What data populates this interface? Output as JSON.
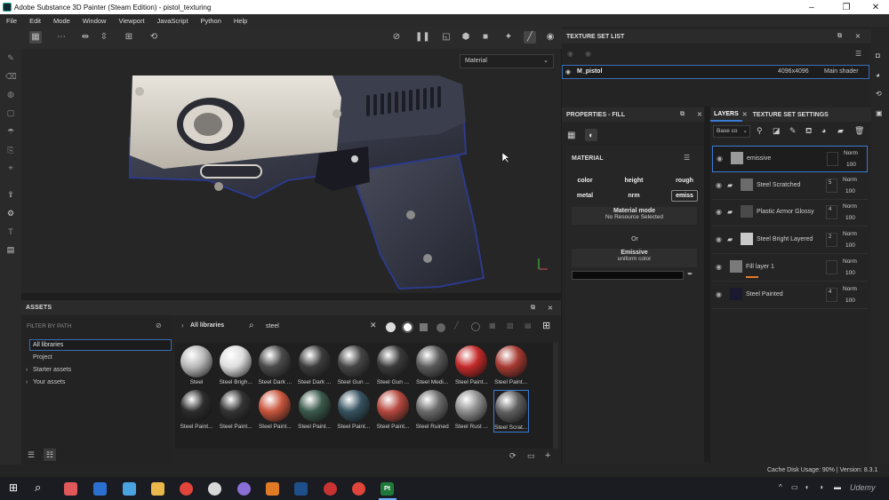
{
  "window": {
    "title": "Adobe Substance 3D Painter (Steam Edition) - pistol_texturing"
  },
  "menu": [
    "File",
    "Edit",
    "Mode",
    "Window",
    "Viewport",
    "JavaScript",
    "Python",
    "Help"
  ],
  "viewport": {
    "material_dropdown": "Material"
  },
  "texture_set_list": {
    "title": "TEXTURE SET LIST",
    "row": {
      "name": "M_pistol",
      "resolution": "4096x4096",
      "shader": "Main shader"
    }
  },
  "properties": {
    "title": "PROPERTIES - FILL",
    "section": "MATERIAL",
    "channels": [
      "color",
      "height",
      "rough",
      "metal",
      "nrm",
      "emiss"
    ],
    "material_mode_title": "Material mode",
    "material_mode_value": "No Resource Selected",
    "or_label": "Or",
    "emissive_title": "Emissive",
    "emissive_value": "uniform color"
  },
  "layers": {
    "tab_layers": "LAYERS",
    "tab_settings": "TEXTURE SET SETTINGS",
    "channel_select": "Base co",
    "items": [
      {
        "name": "emissive",
        "blend": "Norm",
        "opacity": "100"
      },
      {
        "name": "Steel Scratched",
        "blend": "Norm",
        "opacity": "100",
        "count": "5"
      },
      {
        "name": "Plastic Armor Glossy",
        "blend": "Norm",
        "opacity": "100",
        "count": "4"
      },
      {
        "name": "Steel Bright Layered",
        "blend": "Norm",
        "opacity": "100",
        "count": "2"
      },
      {
        "name": "Fill layer 1",
        "blend": "Norm",
        "opacity": "100"
      },
      {
        "name": "Steel Painted",
        "blend": "Norm",
        "opacity": "100",
        "count": "4"
      }
    ]
  },
  "assets": {
    "title": "ASSETS",
    "filter_label": "FILTER BY PATH",
    "tree": [
      "All libraries",
      "Project",
      "Starter assets",
      "Your assets"
    ],
    "breadcrumb": "All libraries",
    "search_value": "steel",
    "items": [
      {
        "label": "Steel",
        "color": "#b9b9b9"
      },
      {
        "label": "Steel Brigh...",
        "color": "#dedede"
      },
      {
        "label": "Steel Dark ...",
        "color": "#4a4a4a"
      },
      {
        "label": "Steel Dark ...",
        "color": "#3c3c3c"
      },
      {
        "label": "Steel Gun ...",
        "color": "#454545"
      },
      {
        "label": "Steel Gun ...",
        "color": "#3a3a3a"
      },
      {
        "label": "Steel Medi...",
        "color": "#5a5a5a"
      },
      {
        "label": "Steel Paint...",
        "color": "#c42a2a"
      },
      {
        "label": "Steel Paint...",
        "color": "#a63a32"
      },
      {
        "label": "Steel Paint...",
        "color": "#2c2c2c"
      },
      {
        "label": "Steel Paint...",
        "color": "#333333"
      },
      {
        "label": "Steel Paint...",
        "color": "#c9553c"
      },
      {
        "label": "Steel Paint...",
        "color": "#3b5a4c"
      },
      {
        "label": "Steel Paint...",
        "color": "#365360"
      },
      {
        "label": "Steel Paint...",
        "color": "#b5483e"
      },
      {
        "label": "Steel Ruined",
        "color": "#6c6c6c"
      },
      {
        "label": "Steel Rust ...",
        "color": "#8e8e8e"
      },
      {
        "label": "Steel Scrat...",
        "color": "#5f5f5f"
      }
    ]
  },
  "status": {
    "text": "Cache Disk Usage:  90% | Version: 8.3.1"
  },
  "watermark": "Udemy",
  "colors": {
    "accent": "#3a7bd5",
    "panel": "#242424",
    "fill_swatch": "#0a0a0a",
    "orange": "#e37b2a"
  }
}
